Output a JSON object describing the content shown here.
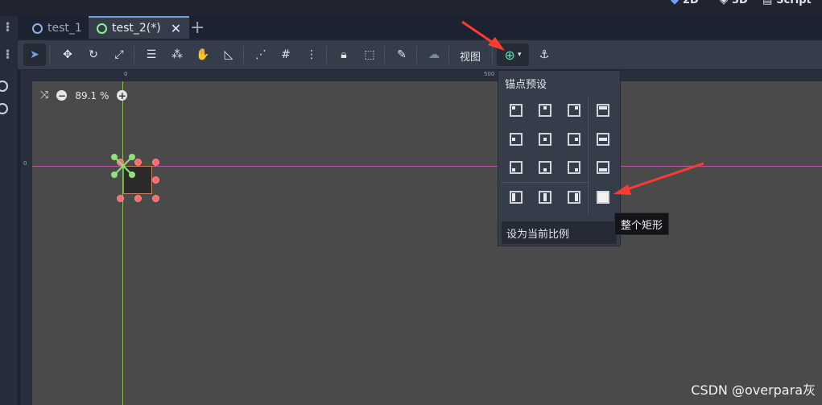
{
  "top_modes": [
    {
      "label": "2D",
      "icon": "2d-icon"
    },
    {
      "label": "3D",
      "icon": "3d-icon"
    },
    {
      "label": "Script",
      "icon": "script-icon"
    }
  ],
  "tabs": [
    {
      "label": "test_1",
      "active": false
    },
    {
      "label": "test_2(*)",
      "active": true
    }
  ],
  "toolbar": {
    "view_label": "视图",
    "tools": [
      "select-tool",
      "move-tool",
      "rotate-tool",
      "scale-tool",
      "list-select-tool",
      "pivot-tool",
      "pan-tool",
      "ruler-tool",
      "smart-snap-toggle",
      "grid-snap-toggle",
      "snap-options-menu",
      "lock-tool",
      "group-tool",
      "skeleton-tool",
      "camera-override-tool",
      "layout-tool",
      "anchor-tool"
    ]
  },
  "rulers": {
    "top_marks": [
      "0",
      "500"
    ],
    "left_marks": [
      "0"
    ]
  },
  "viewport": {
    "zoom": "89.1 %"
  },
  "anchor_menu": {
    "title": "锚点预设",
    "keep_ratio_label": "设为当前比例",
    "presets": [
      [
        "top-left",
        "center-top",
        "top-right",
        "top-wide"
      ],
      [
        "center-left",
        "center",
        "center-right",
        "hcenter-wide"
      ],
      [
        "bottom-left",
        "center-bottom",
        "bottom-right",
        "bottom-wide"
      ],
      [
        "left-wide",
        "vcenter-wide",
        "right-wide",
        "full-rect"
      ]
    ]
  },
  "tooltip": "整个矩形",
  "watermark": "CSDN @overpara灰",
  "colors": {
    "accent": "#6fa5f0",
    "arrow": "#ff3b30",
    "viewport": "#4a4a4a",
    "panel": "#363d4a"
  }
}
